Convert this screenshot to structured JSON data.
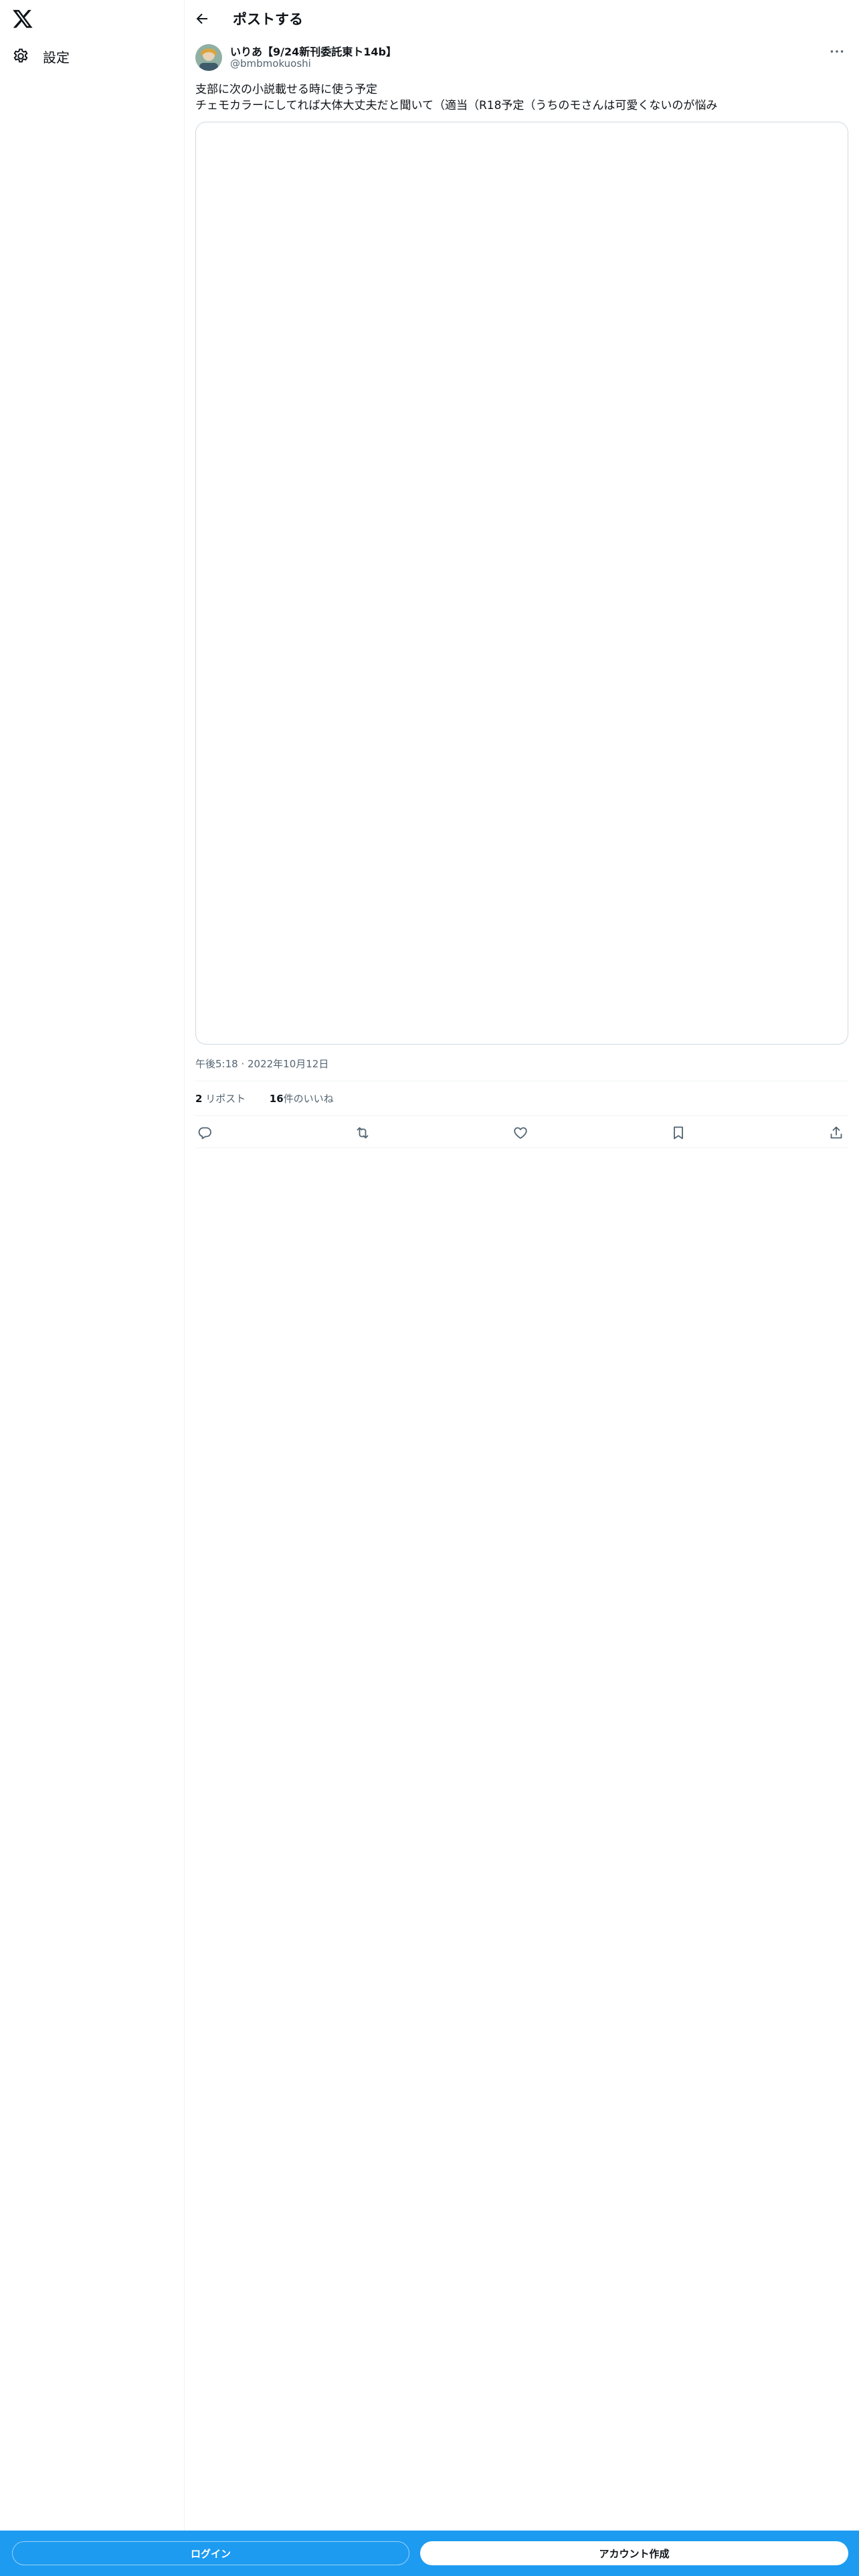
{
  "sidebar": {
    "logo_icon": "x-logo-icon",
    "settings_icon": "gear-icon",
    "settings_label": "設定"
  },
  "header": {
    "back_icon": "arrow-left-icon",
    "title": "ポストする"
  },
  "post": {
    "author_name": "いりあ【9/24新刊委託東ト14b】",
    "author_handle": "@bmbmokuoshi",
    "more_icon": "ellipsis-icon",
    "text": "支部に次の小説載せる時に使う予定\nチェモカラーにしてれば大体大丈夫だと聞いて（適当（R18予定（うちのモさんは可愛くないのが悩み",
    "timestamp": "午後5:18 · 2022年10月12日",
    "reposts_count": "2",
    "reposts_label": "リポスト",
    "likes_count": "16",
    "likes_label": "件のいいね",
    "actions": [
      "reply-icon",
      "repost-icon",
      "like-icon",
      "bookmark-icon",
      "share-icon"
    ]
  },
  "footer": {
    "login_label": "ログイン",
    "signup_label": "アカウント作成"
  },
  "colors": {
    "accent": "#1d9bf0",
    "text": "#0f1419",
    "secondary": "#536471",
    "border": "#eff3f4"
  }
}
